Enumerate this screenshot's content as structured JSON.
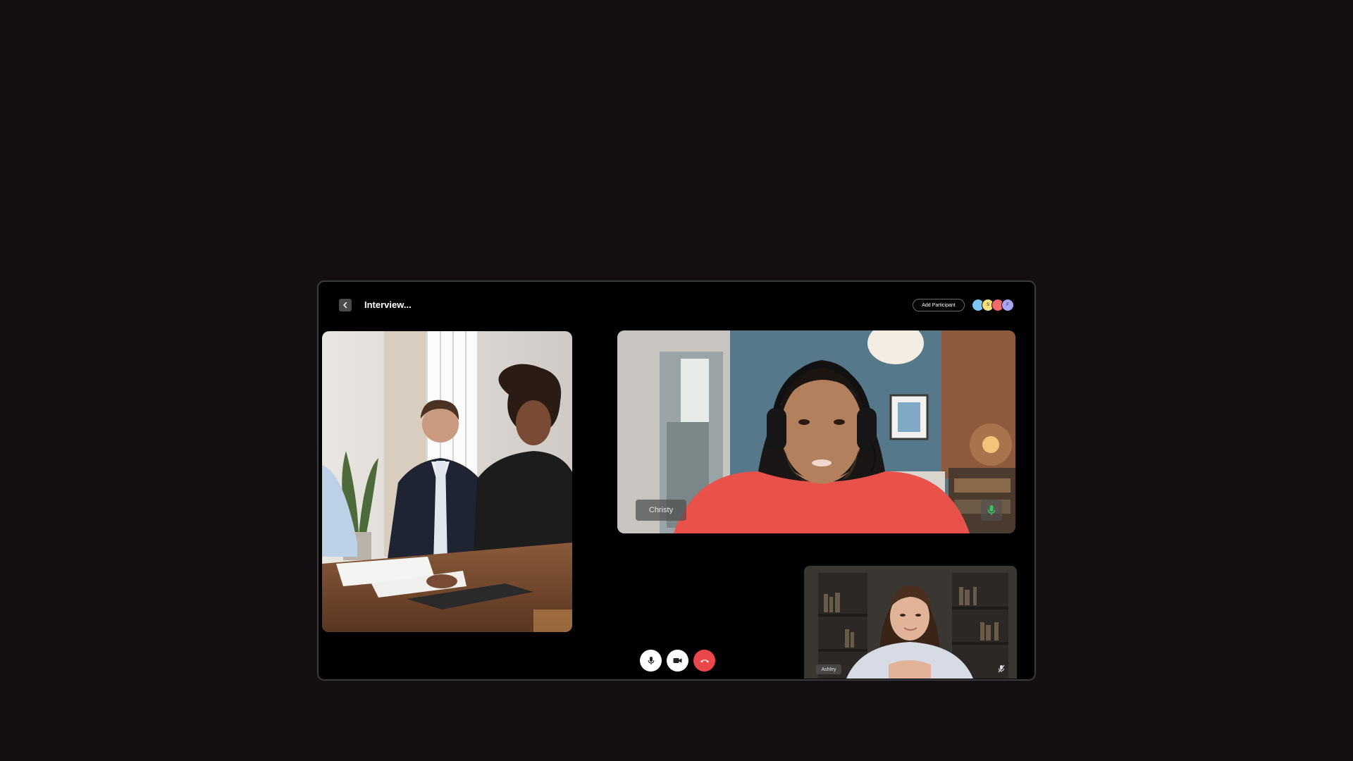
{
  "header": {
    "title": "Interview...",
    "add_participant_label": "Add Participant",
    "avatars": [
      {
        "color": "#7ec6f5",
        "initial": ""
      },
      {
        "color": "#f4e07a",
        "initial": "S"
      },
      {
        "color": "#f26b6b",
        "initial": ""
      },
      {
        "color": "#a7a6f6",
        "initial": "F"
      }
    ]
  },
  "tiles": {
    "main": {
      "name": "Christy"
    },
    "small": {
      "name": "Ashley"
    }
  },
  "colors": {
    "end_call": "#e9474a",
    "mic_active": "#37c45a"
  }
}
